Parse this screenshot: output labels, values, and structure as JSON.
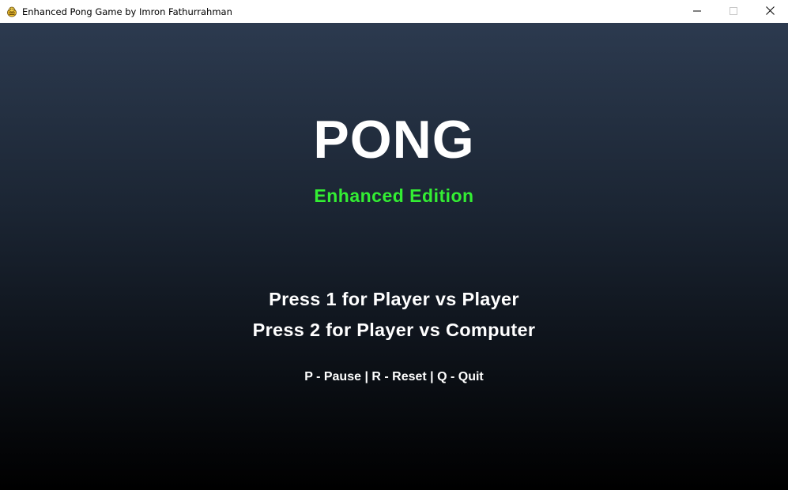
{
  "window": {
    "title": "Enhanced Pong Game by Imron Fathurrahman",
    "icon": "pygame-snake-icon",
    "controls": [
      "minimize-icon",
      "maximize-icon",
      "close-icon"
    ]
  },
  "menu": {
    "title": "PONG",
    "subtitle": "Enhanced Edition",
    "options": [
      {
        "label": "Press 1 for Player vs Player"
      },
      {
        "label": "Press 2 for Player vs Computer"
      }
    ],
    "hint": "P - Pause | R - Reset | Q - Quit"
  },
  "colors": {
    "title": "#ffffff",
    "subtitle": "#33ee33",
    "background_top": "#2c3a4f",
    "background_bottom": "#000000"
  }
}
